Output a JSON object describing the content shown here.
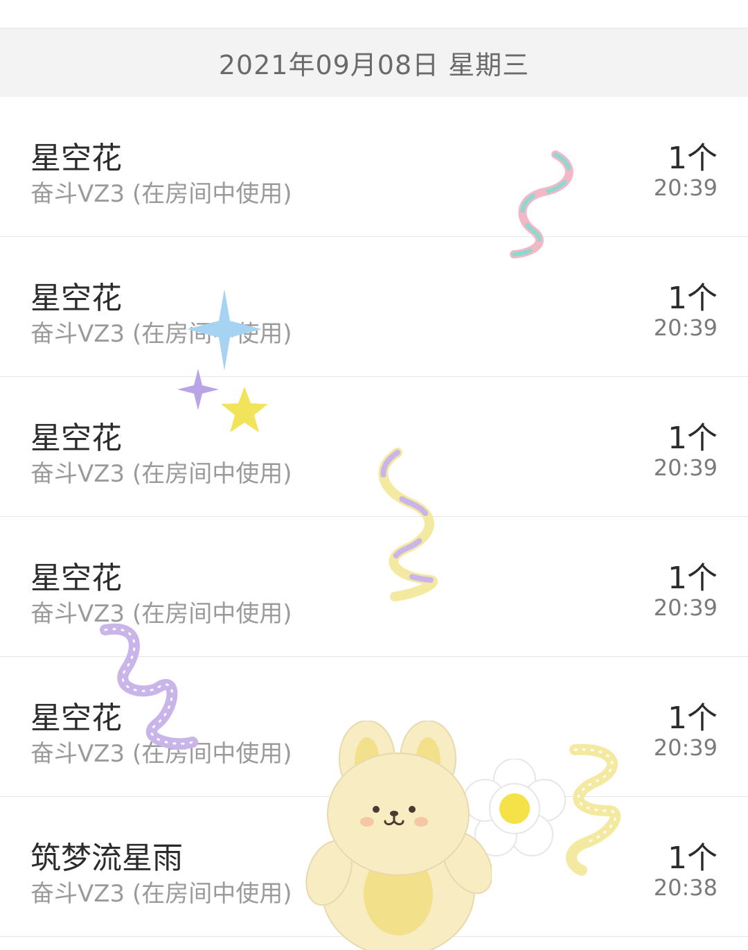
{
  "date_header": "2021年09月08日 星期三",
  "records": [
    {
      "name": "星空花",
      "source": "奋斗VZ3 (在房间中使用)",
      "count": "1个",
      "time": "20:39"
    },
    {
      "name": "星空花",
      "source": "奋斗VZ3 (在房间中使用)",
      "count": "1个",
      "time": "20:39"
    },
    {
      "name": "星空花",
      "source": "奋斗VZ3 (在房间中使用)",
      "count": "1个",
      "time": "20:39"
    },
    {
      "name": "星空花",
      "source": "奋斗VZ3 (在房间中使用)",
      "count": "1个",
      "time": "20:39"
    },
    {
      "name": "星空花",
      "source": "奋斗VZ3 (在房间中使用)",
      "count": "1个",
      "time": "20:39"
    },
    {
      "name": "筑梦流星雨",
      "source": "奋斗VZ3 (在房间中使用)",
      "count": "1个",
      "time": "20:38"
    }
  ],
  "stickers": [
    "ribbon-icon",
    "sparkle-star-icon",
    "star-icon",
    "bunny-icon",
    "flower-icon"
  ],
  "colors": {
    "header_bg": "#f3f3f3",
    "title_text": "#2b2b2b",
    "sub_text": "#9a9a9a",
    "ribbon_teal": "#8fd8cf",
    "ribbon_pink": "#f2b8c6",
    "ribbon_yellow": "#f4e9a0",
    "ribbon_purple": "#c9b5ea",
    "sparkle_blue": "#a7d3f3",
    "sparkle_purple": "#b9a4e6",
    "star_yellow": "#f1e45a",
    "bunny_cream": "#f8ecc2",
    "flower_center": "#f4e248"
  }
}
